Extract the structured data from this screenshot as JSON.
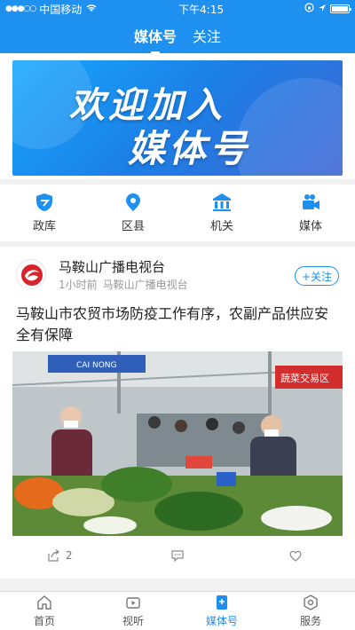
{
  "status": {
    "carrier": "中国移动",
    "time": "下午4:15"
  },
  "header": {
    "tabs": [
      "媒体号",
      "关注"
    ]
  },
  "banner": {
    "line1": "欢迎加入",
    "line2": "媒体号"
  },
  "quick_nav": [
    {
      "label": "政库",
      "icon": "shield-icon"
    },
    {
      "label": "区县",
      "icon": "location-pin-icon"
    },
    {
      "label": "机关",
      "icon": "building-icon"
    },
    {
      "label": "媒体",
      "icon": "video-camera-icon"
    }
  ],
  "post": {
    "author": "马鞍山广播电视台",
    "time": "1小时前",
    "source": "马鞍山广播电视台",
    "follow_label": "+关注",
    "headline": "马鞍山市农贸市场防疫工作有序，农副产品供应安全有保障",
    "photo_signs": {
      "left": "CAI  NONG",
      "right": "蔬菜交易区"
    },
    "share_count": "2"
  },
  "bottom_nav": [
    {
      "label": "首页",
      "icon": "home-icon"
    },
    {
      "label": "视听",
      "icon": "tv-icon"
    },
    {
      "label": "媒体号",
      "icon": "media-account-icon"
    },
    {
      "label": "服务",
      "icon": "service-icon"
    }
  ],
  "colors": {
    "accent": "#1e90f0"
  }
}
